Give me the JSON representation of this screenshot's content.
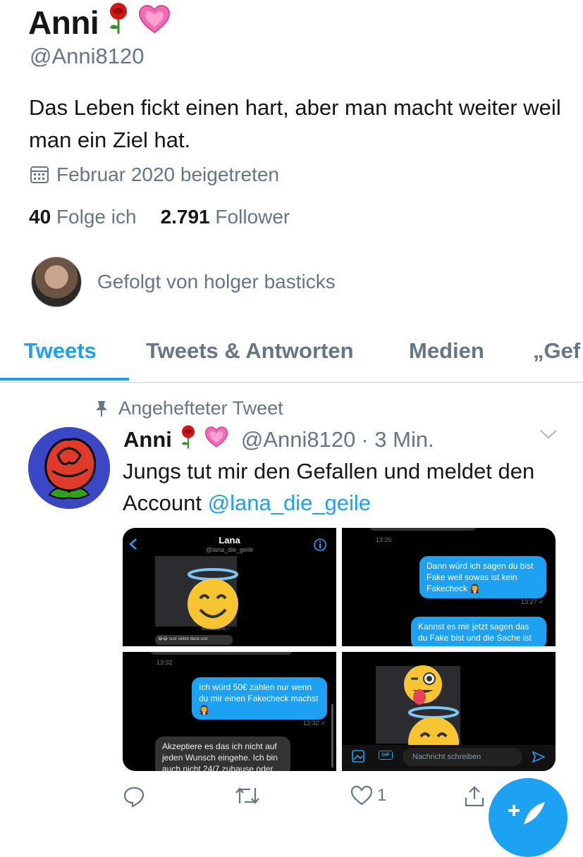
{
  "profile": {
    "name": "Anni",
    "handle": "@Anni8120",
    "bio": "Das Leben fickt einen hart, aber man macht weiter weil man ein Ziel hat.",
    "joined": "Februar 2020 beigetreten",
    "following_count": "40",
    "following_label": "Folge ich",
    "followers_count": "2.791",
    "followers_label": "Follower",
    "followed_by": "Gefolgt von holger basticks"
  },
  "tabs": [
    {
      "label": "Tweets",
      "active": true
    },
    {
      "label": "Tweets & Antworten"
    },
    {
      "label": "Medien"
    },
    {
      "label": "„Gef"
    }
  ],
  "tweet": {
    "pinned_label": "Angehefteter Tweet",
    "author": "Anni",
    "handle": "@Anni8120",
    "time": "· 3 Min.",
    "text_before": "Jungs tut mir den Gefallen und meldet den Account ",
    "mention": "@lana_die_geile",
    "likes": "1"
  },
  "media": {
    "chat_name": "Lana",
    "chat_handle": "@lana_die_geile",
    "small_msg": "😂😂 sust vielen dank und",
    "small_time": "Gesehen 22:39 ✓",
    "t1": "13:26",
    "msg1": "Dann würd ich sagen du bist Fake weil sowas ist kein Fakecheck 🧛",
    "t2": "13:27 ✓",
    "msg2": "Kannst es mir jetzt sagen das du Fake bist und die Sache ist",
    "t3": "13:32",
    "msg3": "Ich würd 50€ zahlen nur wenn du mir einen Fakecheck machst 🧛",
    "t4": "13:32 ✓",
    "msg4": "Akzeptiere es das ich nicht auf jeden Wunsch eingehe. Ich bin auch nicht 24/7 zuhause oder",
    "gif": "GIF",
    "input_placeholder": "Nachricht schreiben"
  },
  "colors": {
    "accent": "#1da1f2",
    "secondary_text": "#657786"
  }
}
